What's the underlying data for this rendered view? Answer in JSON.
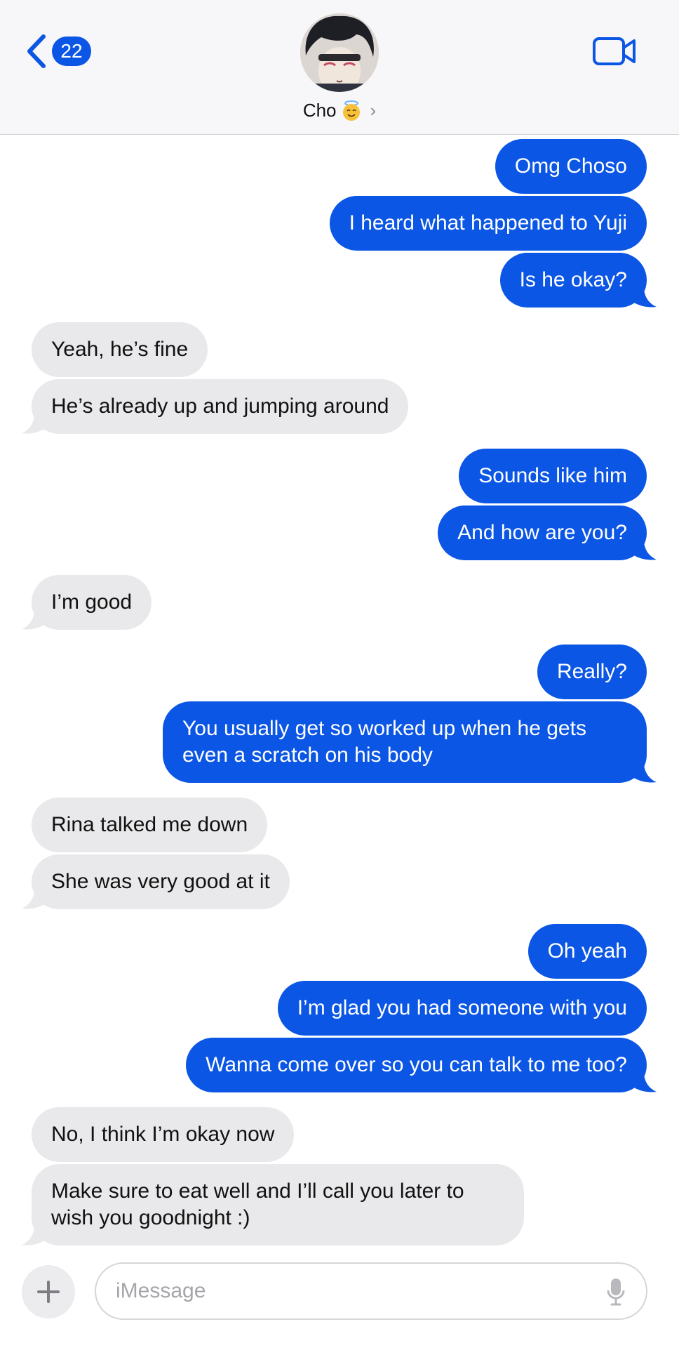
{
  "header": {
    "unread_count": "22",
    "contact_name": "Cho"
  },
  "colors": {
    "outgoing_bubble": "#0b56e4",
    "incoming_bubble": "#e9e9eb",
    "accent": "#0b56e4"
  },
  "icons": {
    "back": "chevron-left-icon",
    "video": "video-camera-icon",
    "contact_emoji": "smiling-face-with-halo-icon",
    "add": "plus-icon",
    "mic": "microphone-icon"
  },
  "messages": [
    {
      "side": "out",
      "text": "Omg Choso"
    },
    {
      "side": "out",
      "text": "I heard what happened to Yuji"
    },
    {
      "side": "out",
      "text": "Is he okay?"
    },
    {
      "side": "in",
      "text": "Yeah, he’s fine"
    },
    {
      "side": "in",
      "text": "He’s already up and jumping around"
    },
    {
      "side": "out",
      "text": "Sounds like him"
    },
    {
      "side": "out",
      "text": "And how are you?"
    },
    {
      "side": "in",
      "text": "I’m good"
    },
    {
      "side": "out",
      "text": "Really?"
    },
    {
      "side": "out",
      "text": "You usually get so worked up when he gets even a scratch on his body"
    },
    {
      "side": "in",
      "text": "Rina talked me down"
    },
    {
      "side": "in",
      "text": "She was very good at it"
    },
    {
      "side": "out",
      "text": "Oh yeah"
    },
    {
      "side": "out",
      "text": "I’m glad you had someone with you"
    },
    {
      "side": "out",
      "text": "Wanna come over so you can talk to me too?"
    },
    {
      "side": "in",
      "text": "No, I think I’m okay now"
    },
    {
      "side": "in",
      "text": "Make sure to eat well and I’ll call you later to wish you goodnight :)"
    }
  ],
  "composer": {
    "placeholder": "iMessage"
  }
}
